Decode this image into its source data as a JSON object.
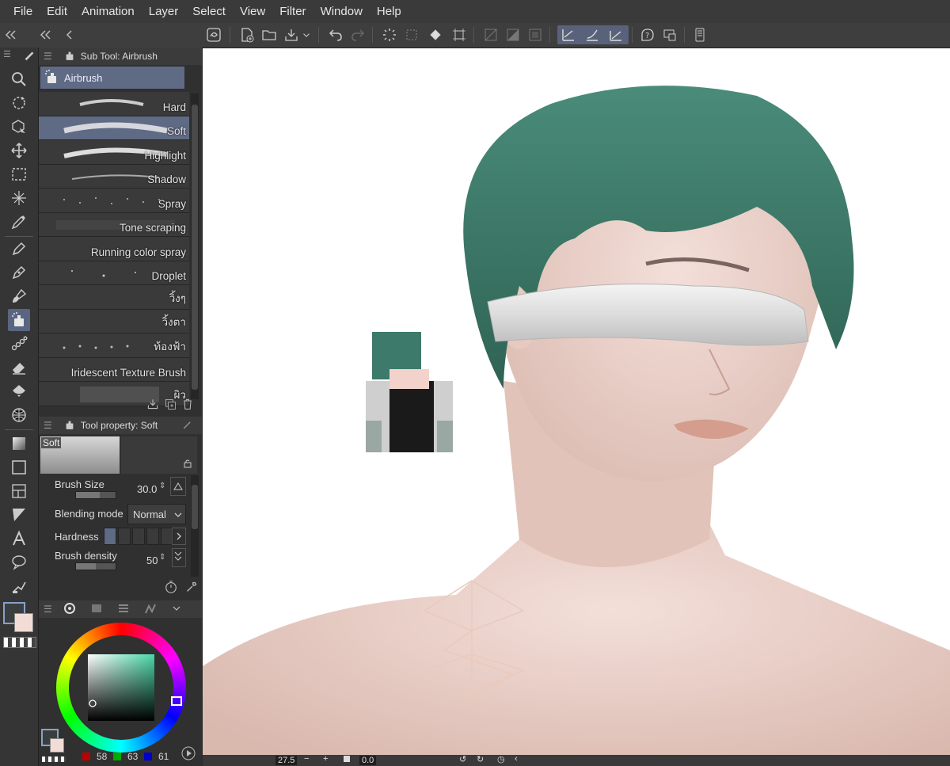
{
  "menubar": {
    "items": [
      "File",
      "Edit",
      "Animation",
      "Layer",
      "Select",
      "View",
      "Filter",
      "Window",
      "Help"
    ]
  },
  "subtool_panel": {
    "title": "Sub Tool: Airbrush",
    "group": "Airbrush",
    "brushes": [
      {
        "label": "Hard",
        "selected": false
      },
      {
        "label": "Soft",
        "selected": true
      },
      {
        "label": "Highlight",
        "selected": false
      },
      {
        "label": "Shadow",
        "selected": false
      },
      {
        "label": "Spray",
        "selected": false
      },
      {
        "label": "Tone scraping",
        "selected": false
      },
      {
        "label": "Running color spray",
        "selected": false
      },
      {
        "label": "Droplet",
        "selected": false
      },
      {
        "label": "วิ้งๆ",
        "selected": false
      },
      {
        "label": "วิ้งตา",
        "selected": false
      },
      {
        "label": "ท้องฟ้า",
        "selected": false
      },
      {
        "label": "Iridescent Texture Brush",
        "selected": false
      },
      {
        "label": "ผิว",
        "selected": false
      }
    ]
  },
  "tool_property": {
    "title": "Tool property: Soft",
    "preview_label": "Soft",
    "brush_size_label": "Brush Size",
    "brush_size_value": "30.0",
    "blending_label": "Blending mode",
    "blending_value": "Normal",
    "hardness_label": "Hardness",
    "hardness_level": 1,
    "density_label": "Brush density",
    "density_value": "50"
  },
  "color": {
    "r": "58",
    "g": "63",
    "b": "61",
    "main_color": "#3a3f3d",
    "sub_color": "#f2ddd6",
    "picker_hue": "#49d8a8"
  },
  "status": {
    "zoom": "27.5",
    "rotation": "0.0"
  },
  "colors": {
    "accent": "#5f6a85",
    "hair": "#3f7a6b"
  }
}
